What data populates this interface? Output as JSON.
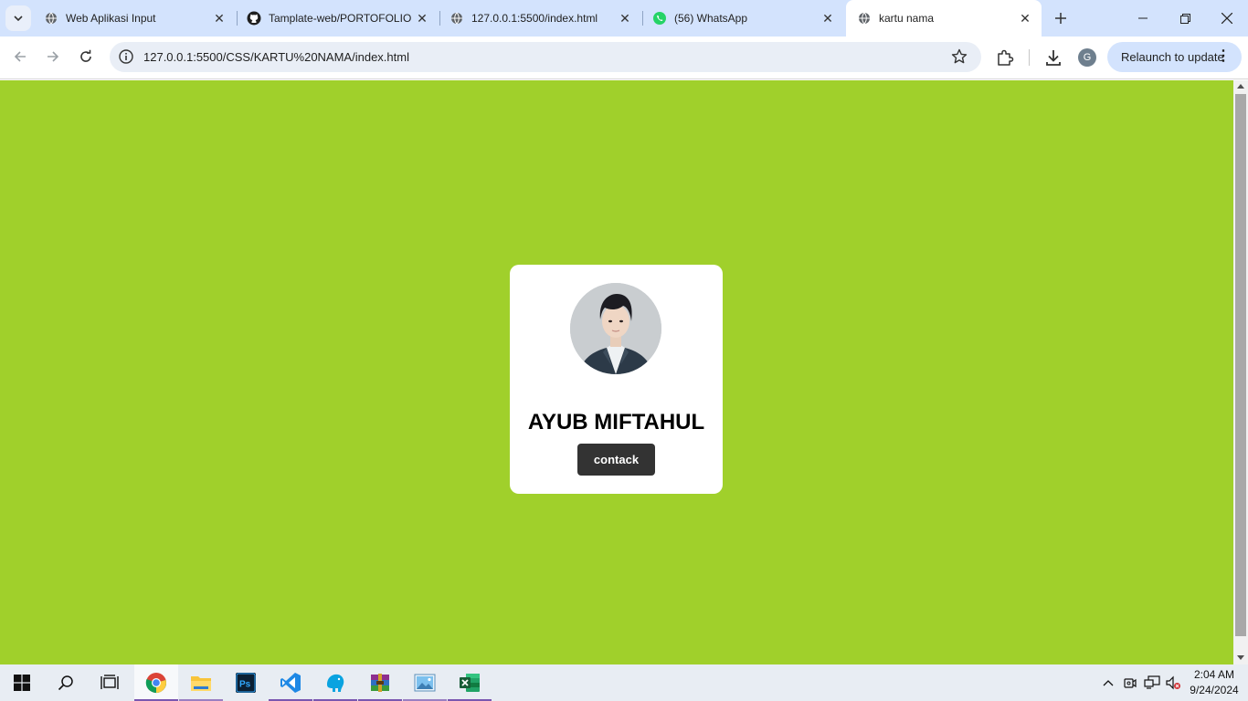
{
  "browser": {
    "tabs": [
      {
        "title": "Web Aplikasi Input",
        "icon": "globe-icon"
      },
      {
        "title": "Tamplate-web/PORTOFOLIO",
        "icon": "github-icon"
      },
      {
        "title": "127.0.0.1:5500/index.html",
        "icon": "globe-icon"
      },
      {
        "title": "(56) WhatsApp",
        "icon": "whatsapp-icon"
      },
      {
        "title": "kartu nama",
        "icon": "globe-icon",
        "active": true
      }
    ],
    "url": "127.0.0.1:5500/CSS/KARTU%20NAMA/index.html",
    "profile_initial": "G",
    "relaunch_label": "Relaunch to update"
  },
  "page": {
    "background_color": "#a0d02b",
    "card": {
      "name": "AYUB MIFTAHUL",
      "button_label": "contack"
    }
  },
  "taskbar": {
    "apps": [
      "start-icon",
      "search-icon",
      "task-view-icon",
      "chrome-icon",
      "file-explorer-icon",
      "photoshop-icon",
      "vscode-icon",
      "mysql-workbench-icon",
      "winrar-icon",
      "photos-icon",
      "excel-icon"
    ],
    "clock": {
      "time": "2:04 AM",
      "date": "9/24/2024"
    }
  }
}
